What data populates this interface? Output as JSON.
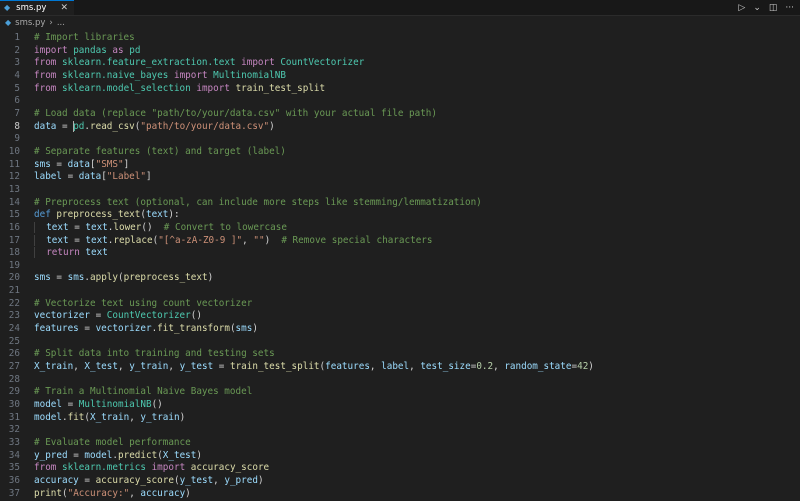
{
  "tab": {
    "filename": "sms.py",
    "close": "✕"
  },
  "breadcrumb": {
    "file": "sms.py",
    "sep": "›",
    "more": "..."
  },
  "actions": {
    "run": "▷",
    "run_menu": "⌄",
    "split": "◫",
    "more": "···"
  },
  "editor": {
    "current_line": 8,
    "lines": [
      [
        [
          "c",
          "# Import libraries"
        ]
      ],
      [
        [
          "k",
          "import"
        ],
        [
          "p",
          " "
        ],
        [
          "cl",
          "pandas"
        ],
        [
          "p",
          " "
        ],
        [
          "k",
          "as"
        ],
        [
          "p",
          " "
        ],
        [
          "cl",
          "pd"
        ]
      ],
      [
        [
          "k",
          "from"
        ],
        [
          "p",
          " "
        ],
        [
          "cl",
          "sklearn.feature_extraction.text"
        ],
        [
          "p",
          " "
        ],
        [
          "k",
          "import"
        ],
        [
          "p",
          " "
        ],
        [
          "cl",
          "CountVectorizer"
        ]
      ],
      [
        [
          "k",
          "from"
        ],
        [
          "p",
          " "
        ],
        [
          "cl",
          "sklearn.naive_bayes"
        ],
        [
          "p",
          " "
        ],
        [
          "k",
          "import"
        ],
        [
          "p",
          " "
        ],
        [
          "cl",
          "MultinomialNB"
        ]
      ],
      [
        [
          "k",
          "from"
        ],
        [
          "p",
          " "
        ],
        [
          "cl",
          "sklearn.model_selection"
        ],
        [
          "p",
          " "
        ],
        [
          "k",
          "import"
        ],
        [
          "p",
          " "
        ],
        [
          "f",
          "train_test_split"
        ]
      ],
      [],
      [
        [
          "c",
          "# Load data (replace \"path/to/your/data.csv\" with your actual file path)"
        ]
      ],
      [
        [
          "v",
          "data"
        ],
        [
          "p",
          " = "
        ],
        [
          "cur",
          ""
        ],
        [
          "cl",
          "pd"
        ],
        [
          "p",
          "."
        ],
        [
          "f",
          "read_csv"
        ],
        [
          "p",
          "("
        ],
        [
          "s",
          "\"path/to/your/data.csv\""
        ],
        [
          "p",
          ")"
        ]
      ],
      [],
      [
        [
          "c",
          "# Separate features (text) and target (label)"
        ]
      ],
      [
        [
          "v",
          "sms"
        ],
        [
          "p",
          " = "
        ],
        [
          "v",
          "data"
        ],
        [
          "p",
          "["
        ],
        [
          "s",
          "\"SMS\""
        ],
        [
          "p",
          "]"
        ]
      ],
      [
        [
          "v",
          "label"
        ],
        [
          "p",
          " = "
        ],
        [
          "v",
          "data"
        ],
        [
          "p",
          "["
        ],
        [
          "s",
          "\"Label\""
        ],
        [
          "p",
          "]"
        ]
      ],
      [],
      [
        [
          "c",
          "# Preprocess text (optional, can include more steps like stemming/lemmatization)"
        ]
      ],
      [
        [
          "kw",
          "def"
        ],
        [
          "p",
          " "
        ],
        [
          "f",
          "preprocess_text"
        ],
        [
          "p",
          "("
        ],
        [
          "v",
          "text"
        ],
        [
          "p",
          "):"
        ]
      ],
      [
        [
          "ind",
          "  "
        ],
        [
          "v",
          "text"
        ],
        [
          "p",
          " = "
        ],
        [
          "v",
          "text"
        ],
        [
          "p",
          "."
        ],
        [
          "f",
          "lower"
        ],
        [
          "p",
          "()  "
        ],
        [
          "c",
          "# Convert to lowercase"
        ]
      ],
      [
        [
          "ind",
          "  "
        ],
        [
          "v",
          "text"
        ],
        [
          "p",
          " = "
        ],
        [
          "v",
          "text"
        ],
        [
          "p",
          "."
        ],
        [
          "f",
          "replace"
        ],
        [
          "p",
          "("
        ],
        [
          "s",
          "\"[^a-zA-Z0-9 ]\""
        ],
        [
          "p",
          ", "
        ],
        [
          "s",
          "\"\""
        ],
        [
          "p",
          ")  "
        ],
        [
          "c",
          "# Remove special characters"
        ]
      ],
      [
        [
          "ind",
          "  "
        ],
        [
          "k",
          "return"
        ],
        [
          "p",
          " "
        ],
        [
          "v",
          "text"
        ]
      ],
      [],
      [
        [
          "v",
          "sms"
        ],
        [
          "p",
          " = "
        ],
        [
          "v",
          "sms"
        ],
        [
          "p",
          "."
        ],
        [
          "f",
          "apply"
        ],
        [
          "p",
          "("
        ],
        [
          "f",
          "preprocess_text"
        ],
        [
          "p",
          ")"
        ]
      ],
      [],
      [
        [
          "c",
          "# Vectorize text using count vectorizer"
        ]
      ],
      [
        [
          "v",
          "vectorizer"
        ],
        [
          "p",
          " = "
        ],
        [
          "cl",
          "CountVectorizer"
        ],
        [
          "p",
          "()"
        ]
      ],
      [
        [
          "v",
          "features"
        ],
        [
          "p",
          " = "
        ],
        [
          "v",
          "vectorizer"
        ],
        [
          "p",
          "."
        ],
        [
          "f",
          "fit_transform"
        ],
        [
          "p",
          "("
        ],
        [
          "v",
          "sms"
        ],
        [
          "p",
          ")"
        ]
      ],
      [],
      [
        [
          "c",
          "# Split data into training and testing sets"
        ]
      ],
      [
        [
          "v",
          "X_train"
        ],
        [
          "p",
          ", "
        ],
        [
          "v",
          "X_test"
        ],
        [
          "p",
          ", "
        ],
        [
          "v",
          "y_train"
        ],
        [
          "p",
          ", "
        ],
        [
          "v",
          "y_test"
        ],
        [
          "p",
          " = "
        ],
        [
          "f",
          "train_test_split"
        ],
        [
          "p",
          "("
        ],
        [
          "v",
          "features"
        ],
        [
          "p",
          ", "
        ],
        [
          "v",
          "label"
        ],
        [
          "p",
          ", "
        ],
        [
          "v",
          "test_size"
        ],
        [
          "p",
          "="
        ],
        [
          "n",
          "0.2"
        ],
        [
          "p",
          ", "
        ],
        [
          "v",
          "random_state"
        ],
        [
          "p",
          "="
        ],
        [
          "n",
          "42"
        ],
        [
          "p",
          ")"
        ]
      ],
      [],
      [
        [
          "c",
          "# Train a Multinomial Naive Bayes model"
        ]
      ],
      [
        [
          "v",
          "model"
        ],
        [
          "p",
          " = "
        ],
        [
          "cl",
          "MultinomialNB"
        ],
        [
          "p",
          "()"
        ]
      ],
      [
        [
          "v",
          "model"
        ],
        [
          "p",
          "."
        ],
        [
          "f",
          "fit"
        ],
        [
          "p",
          "("
        ],
        [
          "v",
          "X_train"
        ],
        [
          "p",
          ", "
        ],
        [
          "v",
          "y_train"
        ],
        [
          "p",
          ")"
        ]
      ],
      [],
      [
        [
          "c",
          "# Evaluate model performance"
        ]
      ],
      [
        [
          "v",
          "y_pred"
        ],
        [
          "p",
          " = "
        ],
        [
          "v",
          "model"
        ],
        [
          "p",
          "."
        ],
        [
          "f",
          "predict"
        ],
        [
          "p",
          "("
        ],
        [
          "v",
          "X_test"
        ],
        [
          "p",
          ")"
        ]
      ],
      [
        [
          "k",
          "from"
        ],
        [
          "p",
          " "
        ],
        [
          "cl",
          "sklearn.metrics"
        ],
        [
          "p",
          " "
        ],
        [
          "k",
          "import"
        ],
        [
          "p",
          " "
        ],
        [
          "f",
          "accuracy_score"
        ]
      ],
      [
        [
          "v",
          "accuracy"
        ],
        [
          "p",
          " = "
        ],
        [
          "f",
          "accuracy_score"
        ],
        [
          "p",
          "("
        ],
        [
          "v",
          "y_test"
        ],
        [
          "p",
          ", "
        ],
        [
          "v",
          "y_pred"
        ],
        [
          "p",
          ")"
        ]
      ],
      [
        [
          "f",
          "print"
        ],
        [
          "p",
          "("
        ],
        [
          "s",
          "\"Accuracy:\""
        ],
        [
          "p",
          ", "
        ],
        [
          "v",
          "accuracy"
        ],
        [
          "p",
          ")"
        ]
      ]
    ]
  }
}
